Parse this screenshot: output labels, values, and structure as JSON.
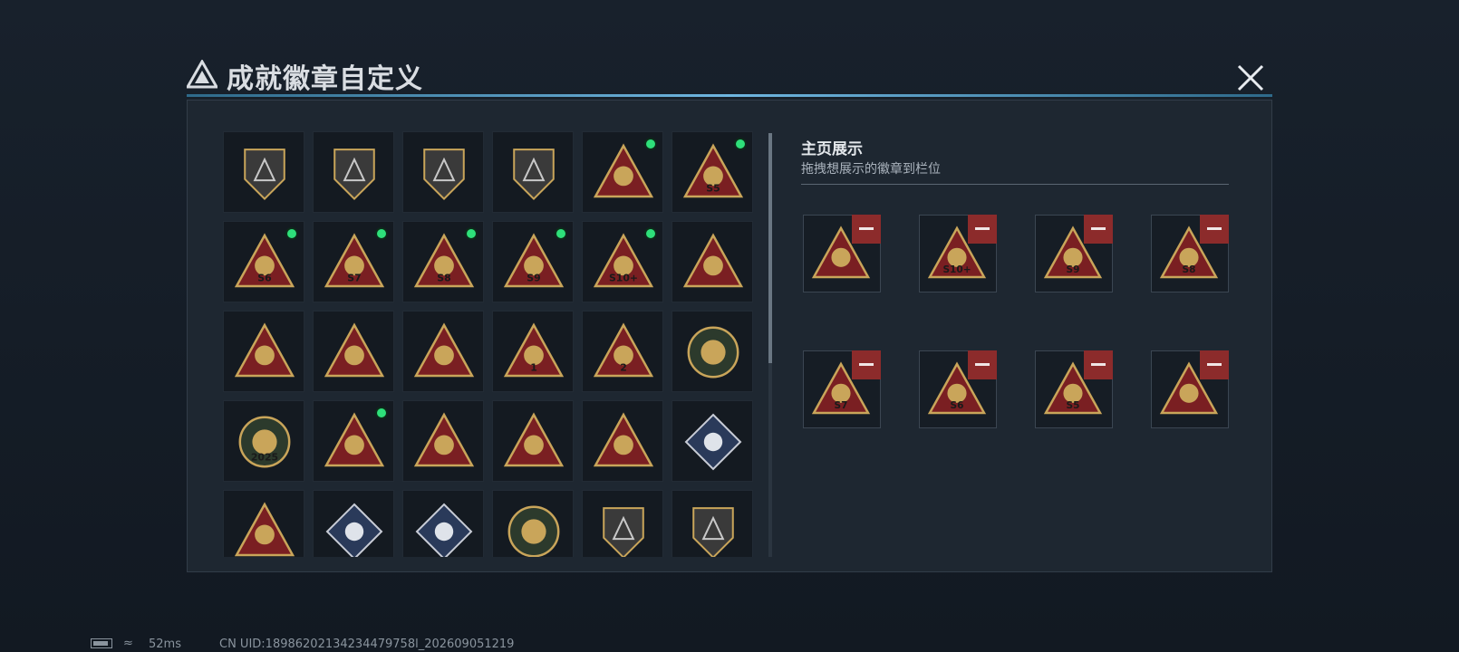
{
  "modal": {
    "title": "成就徽章自定义",
    "logo_icon": "delta-logo-icon",
    "close_icon": "close-icon"
  },
  "display": {
    "title": "主页展示",
    "subtitle": "拖拽想展示的徽章到栏位",
    "slots": [
      {
        "badge": "trophy-box",
        "label": ""
      },
      {
        "badge": "eagle-s10",
        "label": "S10+"
      },
      {
        "badge": "cannon-s9",
        "label": "S9"
      },
      {
        "badge": "lantern-s8",
        "label": "S8"
      },
      {
        "badge": "box-s7",
        "label": "S7"
      },
      {
        "badge": "vest-s6",
        "label": "S6"
      },
      {
        "badge": "pack-s5",
        "label": "S5"
      },
      {
        "badge": "radar",
        "label": ""
      }
    ],
    "remove_icon": "minus-icon"
  },
  "badges": [
    {
      "shape": "shield",
      "glyph": "delta",
      "selected": false,
      "label": ""
    },
    {
      "shape": "shield",
      "glyph": "helicopter",
      "selected": false,
      "label": ""
    },
    {
      "shape": "shield",
      "glyph": "diamond",
      "selected": false,
      "label": ""
    },
    {
      "shape": "shield",
      "glyph": "blade",
      "selected": false,
      "label": ""
    },
    {
      "shape": "triangle",
      "glyph": "radar",
      "selected": true,
      "label": ""
    },
    {
      "shape": "triangle",
      "glyph": "pack",
      "selected": true,
      "label": "S5"
    },
    {
      "shape": "triangle",
      "glyph": "vest",
      "selected": true,
      "label": "S6"
    },
    {
      "shape": "triangle",
      "glyph": "box",
      "selected": true,
      "label": "S7"
    },
    {
      "shape": "triangle",
      "glyph": "lantern",
      "selected": true,
      "label": "S8"
    },
    {
      "shape": "triangle",
      "glyph": "cannon",
      "selected": true,
      "label": "S9"
    },
    {
      "shape": "triangle",
      "glyph": "eagle",
      "selected": true,
      "label": "S10+"
    },
    {
      "shape": "triangle",
      "glyph": "medal",
      "selected": false,
      "label": ""
    },
    {
      "shape": "triangle",
      "glyph": "cup",
      "selected": false,
      "label": ""
    },
    {
      "shape": "triangle",
      "glyph": "bowl",
      "selected": false,
      "label": ""
    },
    {
      "shape": "triangle",
      "glyph": "sniper",
      "selected": false,
      "label": ""
    },
    {
      "shape": "triangle",
      "glyph": "one",
      "selected": false,
      "label": "1"
    },
    {
      "shape": "triangle",
      "glyph": "two",
      "selected": false,
      "label": "2"
    },
    {
      "shape": "round",
      "glyph": "crocodile",
      "selected": false,
      "label": ""
    },
    {
      "shape": "round",
      "glyph": "delta-force-2025",
      "selected": false,
      "label": "2025"
    },
    {
      "shape": "triangle",
      "glyph": "trophy-box",
      "selected": true,
      "label": ""
    },
    {
      "shape": "triangle",
      "glyph": "kneel",
      "selected": false,
      "label": ""
    },
    {
      "shape": "triangle",
      "glyph": "hands",
      "selected": false,
      "label": ""
    },
    {
      "shape": "triangle",
      "glyph": "squad",
      "selected": false,
      "label": ""
    },
    {
      "shape": "diamond",
      "glyph": "gem",
      "selected": false,
      "label": ""
    },
    {
      "shape": "triangle",
      "glyph": "diver",
      "selected": false,
      "label": ""
    },
    {
      "shape": "diamond",
      "glyph": "launcher",
      "selected": false,
      "label": ""
    },
    {
      "shape": "diamond",
      "glyph": "jetski",
      "selected": false,
      "label": ""
    },
    {
      "shape": "round",
      "glyph": "star",
      "selected": false,
      "label": ""
    },
    {
      "shape": "shield",
      "glyph": "crest",
      "selected": false,
      "label": ""
    },
    {
      "shape": "shield",
      "glyph": "stars-crest",
      "selected": false,
      "label": ""
    }
  ],
  "colors": {
    "gold": "#c9a55a",
    "red": "#7a1f22",
    "selected_dot": "#2ee07a",
    "remove": "#8c2b2b",
    "accent": "#6fb6e0"
  },
  "status": {
    "ping": "52ms",
    "uid": "CN UID:18986202134234479758l_202609051219"
  }
}
